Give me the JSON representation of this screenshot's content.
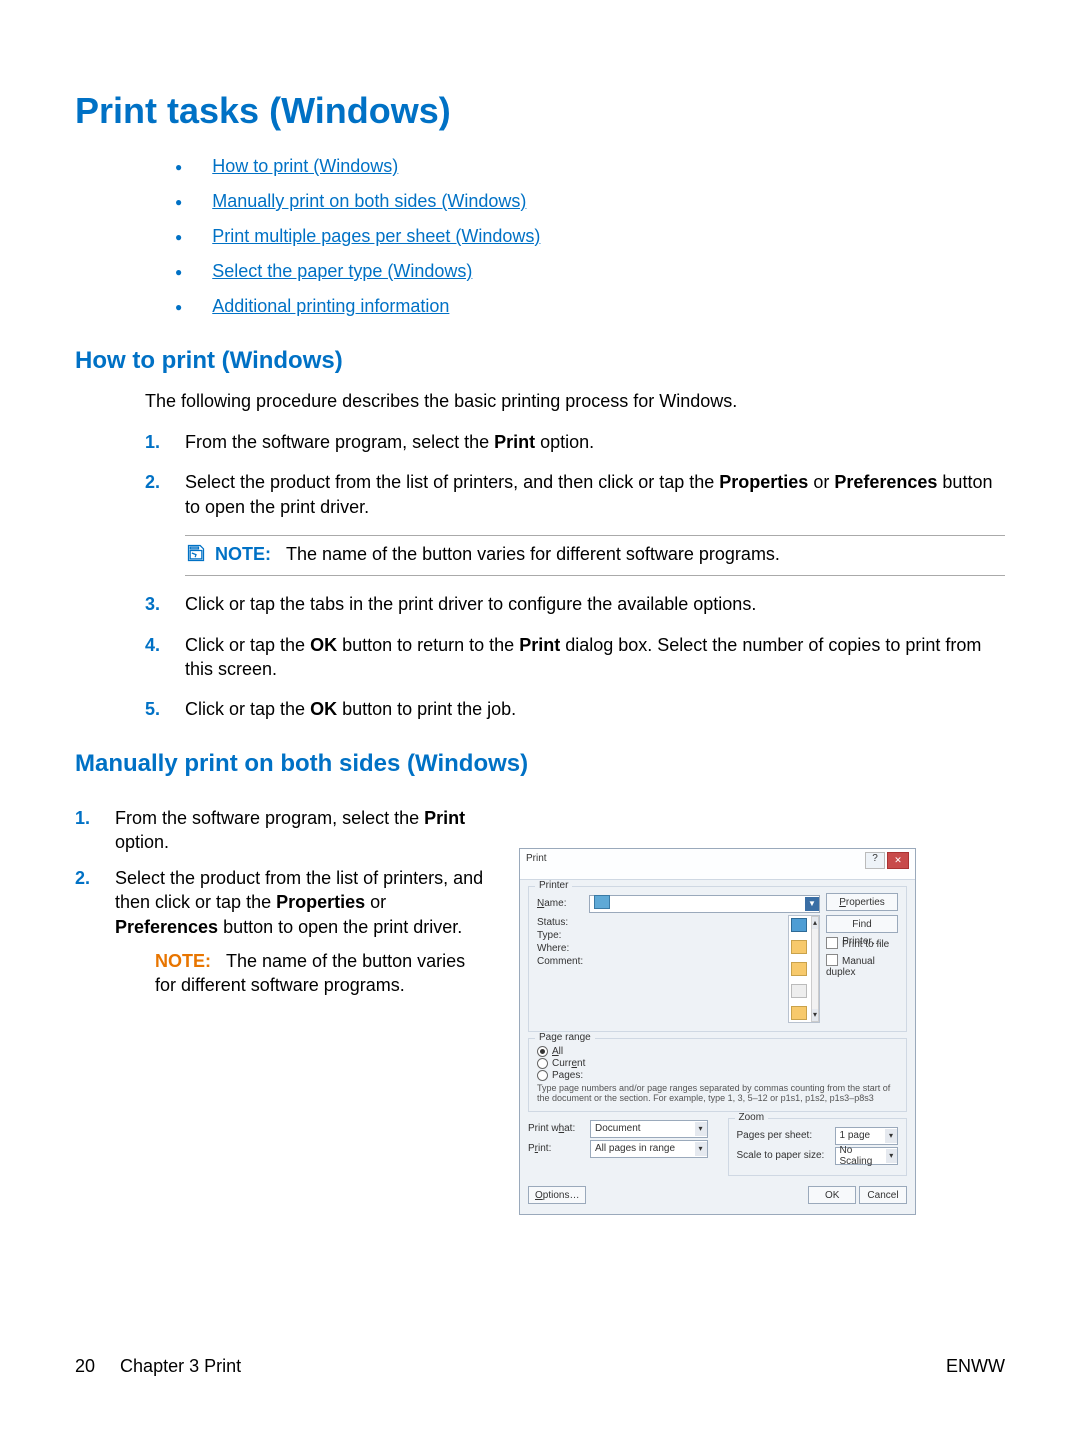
{
  "title": "Print tasks (Windows)",
  "toc": [
    "How to print (Windows)",
    "Manually print on both sides (Windows)",
    "Print multiple pages per sheet (Windows)",
    "Select the paper type (Windows)",
    "Additional printing information"
  ],
  "section1": {
    "heading": "How to print (Windows)",
    "intro": "The following procedure describes the basic printing process for Windows.",
    "steps": {
      "s1_a": "From the software program, select the ",
      "s1_b": "Print",
      "s1_c": " option.",
      "s2_a": "Select the product from the list of printers, and then click or tap the ",
      "s2_b": "Properties",
      "s2_c": " or ",
      "s2_d": "Preferences",
      "s2_e": " button to open the print driver.",
      "note_prefix": "NOTE:",
      "note_text": "The name of the button varies for different software programs.",
      "s3": "Click or tap the tabs in the print driver to configure the available options.",
      "s4_a": "Click or tap the ",
      "s4_b": "OK",
      "s4_c": " button to return to the ",
      "s4_d": "Print",
      "s4_e": " dialog box. Select the number of copies to print from this screen.",
      "s5_a": "Click or tap the ",
      "s5_b": "OK",
      "s5_c": " button to print the job."
    }
  },
  "section2": {
    "heading": "Manually print on both sides (Windows)",
    "s1_a": "From the software program, select the ",
    "s1_b": "Print",
    "s1_c": " option.",
    "s2_a": "Select the product from the list of printers, and then click or tap the ",
    "s2_b": "Properties",
    "s2_c": " or ",
    "s2_d": "Preferences",
    "s2_e": " button to open the print driver.",
    "note_prefix": "NOTE:",
    "note_text": "The name of the button varies for different software programs."
  },
  "dialog": {
    "title": "Print",
    "printer_legend": "Printer",
    "name_lbl": "Name:",
    "status_lbl": "Status:",
    "type_lbl": "Type:",
    "where_lbl": "Where:",
    "comment_lbl": "Comment:",
    "properties_btn": "Properties",
    "findprinter_btn": "Find Printer…",
    "printfile_chk": "Print to file",
    "manualduplex_chk": "Manual duplex",
    "pagerange_legend": "Page range",
    "radio_all": "All",
    "radio_current": "Current",
    "radio_pages": "Pages:",
    "pagerange_hint": "Type page numbers and/or page ranges separated by commas counting from the start of the document or the section. For example, type 1, 3, 5–12 or p1s1, p1s2, p1s3–p8s3",
    "printwhat_lbl": "Print what:",
    "printwhat_val": "Document",
    "print_lbl": "Print:",
    "print_val": "All pages in range",
    "zoom_legend": "Zoom",
    "pps_lbl": "Pages per sheet:",
    "pps_val": "1 page",
    "scale_lbl": "Scale to paper size:",
    "scale_val": "No Scaling",
    "options_btn": "Options…",
    "ok_btn": "OK",
    "cancel_btn": "Cancel"
  },
  "footer": {
    "page": "20",
    "chapter": "Chapter 3   Print",
    "right": "ENWW"
  }
}
